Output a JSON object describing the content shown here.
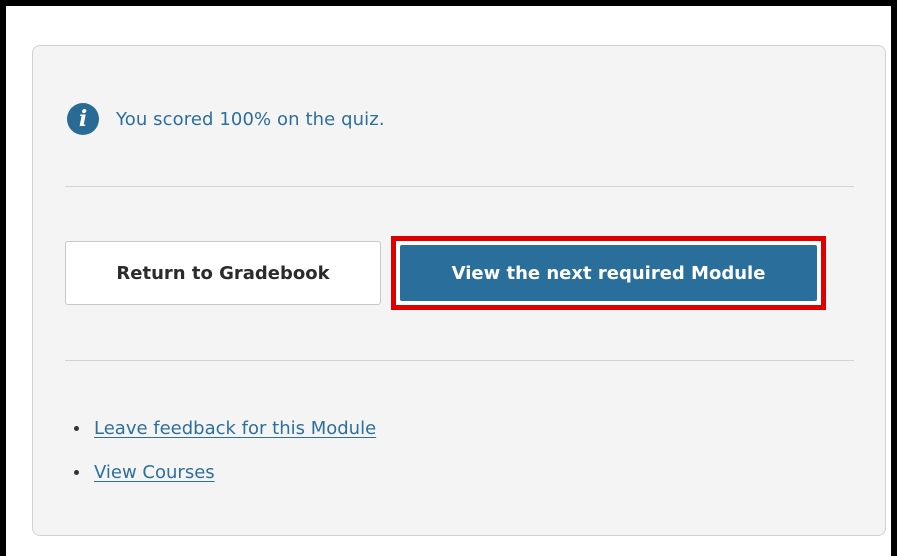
{
  "notice": {
    "icon": "info-icon",
    "icon_glyph": "i",
    "text": "You scored 100% on the quiz."
  },
  "actions": {
    "return_label": "Return to Gradebook",
    "next_label": "View the next required Module"
  },
  "links": [
    {
      "label": "Leave feedback for this Module"
    },
    {
      "label": "View Courses"
    }
  ],
  "colors": {
    "accent": "#2a6f9c",
    "link": "#2d6f9b",
    "highlight": "#e00000",
    "card_bg": "#f4f4f4"
  }
}
